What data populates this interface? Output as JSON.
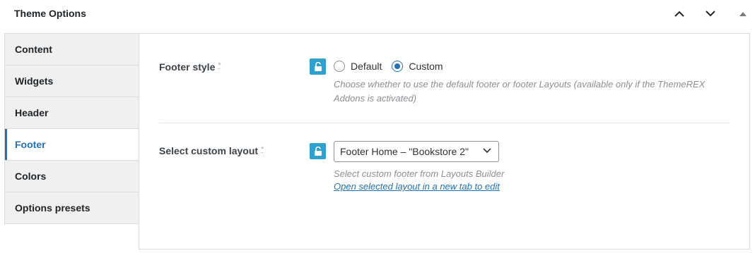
{
  "panel": {
    "title": "Theme Options"
  },
  "tabs": [
    {
      "label": "Content",
      "active": false
    },
    {
      "label": "Widgets",
      "active": false
    },
    {
      "label": "Header",
      "active": false
    },
    {
      "label": "Footer",
      "active": true
    },
    {
      "label": "Colors",
      "active": false
    },
    {
      "label": "Options presets",
      "active": false
    }
  ],
  "footer_style": {
    "label": "Footer style",
    "required_mark": "*",
    "options": [
      "Default",
      "Custom"
    ],
    "selected": "Custom",
    "description": "Choose whether to use the default footer or footer Layouts (available only if the ThemeREX",
    "description_line2": "Addons is activated)"
  },
  "custom_layout": {
    "label": "Select custom layout",
    "required_mark": "*",
    "selected_value": "Footer Home – \"Bookstore 2\"",
    "description": "Select custom footer from Layouts Builder",
    "link_text": "Open selected layout in a new tab to edit"
  },
  "colors": {
    "accent": "#2271b1",
    "lock_button": "#2ea2cc"
  },
  "icons": {
    "move_up": "chevron-up-icon",
    "move_down": "chevron-down-icon",
    "toggle": "triangle-up-icon",
    "lock": "unlock-icon"
  }
}
